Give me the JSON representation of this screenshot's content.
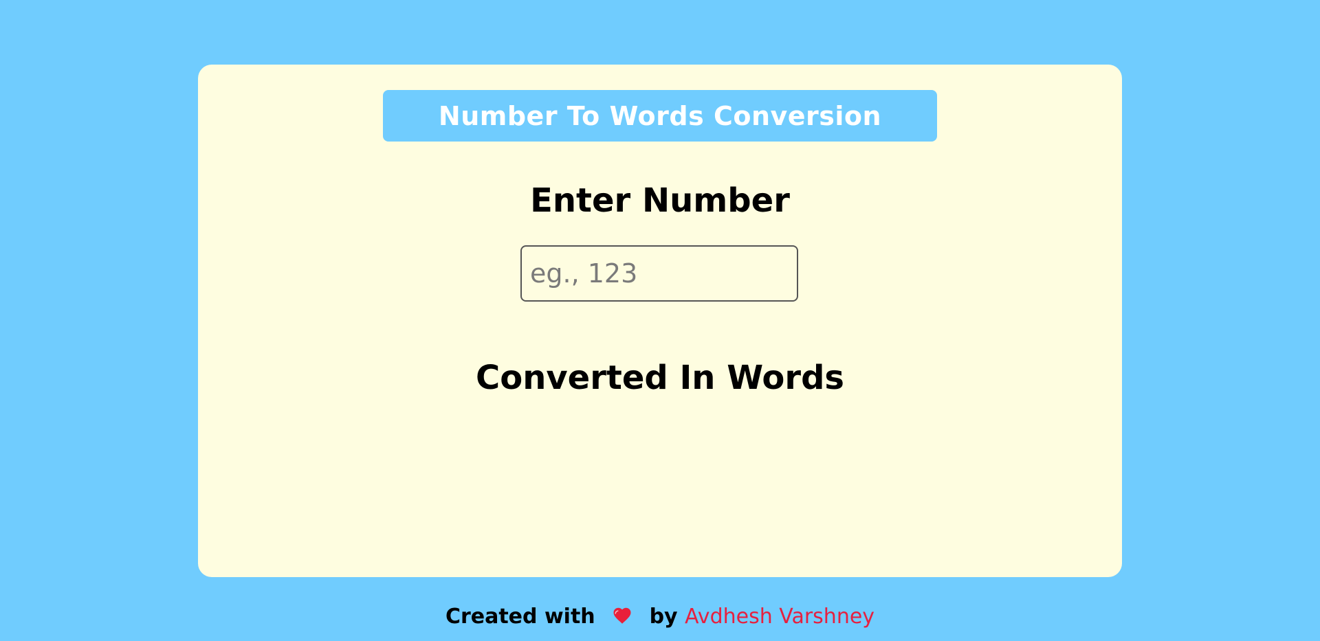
{
  "header": {
    "title": "Number To Words Conversion"
  },
  "input": {
    "label": "Enter Number",
    "value": "",
    "placeholder": "eg., 123"
  },
  "output": {
    "label": "Converted In Words",
    "value": ""
  },
  "footer": {
    "prefix": "Created with",
    "icon": "heart-icon",
    "by": "by",
    "author": "Avdhesh Varshney"
  },
  "colors": {
    "background": "#70ccfe",
    "card": "#fefde0",
    "title_bar": "#70ccfe",
    "author": "#e6203f",
    "heart": "#e8203a"
  }
}
